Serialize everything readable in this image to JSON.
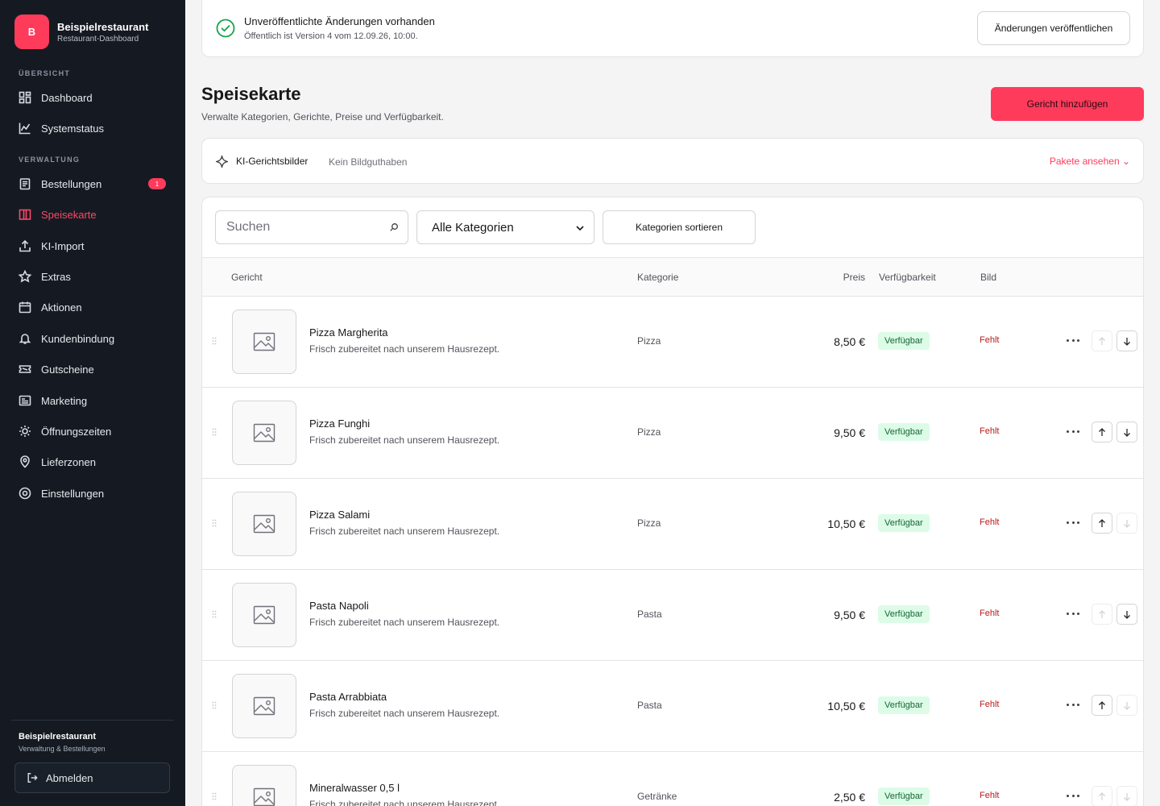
{
  "brand": {
    "initial": "B",
    "name": "Beispielrestaurant",
    "subtitle": "Restaurant-Dashboard"
  },
  "sidebar": {
    "section_overview": "ÜBERSICHT",
    "section_admin": "VERWALTUNG",
    "items": [
      {
        "label": "Dashboard",
        "icon": "dashboard-icon"
      },
      {
        "label": "Systemstatus",
        "icon": "chart-icon"
      },
      {
        "label": "Bestellungen",
        "icon": "clipboard-icon",
        "badge": "1"
      },
      {
        "label": "Speisekarte",
        "icon": "menu-book-icon",
        "active": true
      },
      {
        "label": "KI-Import",
        "icon": "upload-icon"
      },
      {
        "label": "Extras",
        "icon": "star-icon"
      },
      {
        "label": "Aktionen",
        "icon": "calendar-icon"
      },
      {
        "label": "Kundenbindung",
        "icon": "bell-icon"
      },
      {
        "label": "Gutscheine",
        "icon": "ticket-icon"
      },
      {
        "label": "Marketing",
        "icon": "newsletter-icon"
      },
      {
        "label": "Öffnungszeiten",
        "icon": "sun-icon"
      },
      {
        "label": "Lieferzonen",
        "icon": "map-pin-icon"
      },
      {
        "label": "Einstellungen",
        "icon": "settings-icon"
      }
    ],
    "footer": {
      "name": "Beispielrestaurant",
      "subtitle": "Verwaltung & Bestellungen",
      "logout": "Abmelden"
    }
  },
  "publish": {
    "title": "Unveröffentlichte Änderungen vorhanden",
    "subtitle": "Öffentlich ist Version 4 vom 12.09.26, 10:00.",
    "button": "Änderungen veröffentlichen"
  },
  "page": {
    "title": "Speisekarte",
    "subtitle": "Verwalte Kategorien, Gerichte, Preise und Verfügbarkeit.",
    "add_button": "Gericht hinzufügen"
  },
  "ai_images": {
    "title": "KI-Gerichtsbilder",
    "status": "Kein Bildguthaben",
    "link": "Pakete ansehen ⌄"
  },
  "toolbar": {
    "search_placeholder": "Suchen",
    "category_select": "Alle Kategorien",
    "sort_button": "Kategorien sortieren"
  },
  "table": {
    "headers": {
      "dish": "Gericht",
      "category": "Kategorie",
      "price": "Preis",
      "availability": "Verfügbarkeit",
      "image": "Bild"
    },
    "rows": [
      {
        "name": "Pizza Margherita",
        "description": "Frisch zubereitet nach unserem Hausrezept.",
        "category": "Pizza",
        "price": "8,50 €",
        "availability": "Verfügbar",
        "image": "Fehlt",
        "up_enabled": false,
        "down_enabled": true
      },
      {
        "name": "Pizza Funghi",
        "description": "Frisch zubereitet nach unserem Hausrezept.",
        "category": "Pizza",
        "price": "9,50 €",
        "availability": "Verfügbar",
        "image": "Fehlt",
        "up_enabled": true,
        "down_enabled": true
      },
      {
        "name": "Pizza Salami",
        "description": "Frisch zubereitet nach unserem Hausrezept.",
        "category": "Pizza",
        "price": "10,50 €",
        "availability": "Verfügbar",
        "image": "Fehlt",
        "up_enabled": true,
        "down_enabled": false
      },
      {
        "name": "Pasta Napoli",
        "description": "Frisch zubereitet nach unserem Hausrezept.",
        "category": "Pasta",
        "price": "9,50 €",
        "availability": "Verfügbar",
        "image": "Fehlt",
        "up_enabled": false,
        "down_enabled": true
      },
      {
        "name": "Pasta Arrabbiata",
        "description": "Frisch zubereitet nach unserem Hausrezept.",
        "category": "Pasta",
        "price": "10,50 €",
        "availability": "Verfügbar",
        "image": "Fehlt",
        "up_enabled": true,
        "down_enabled": false
      },
      {
        "name": "Mineralwasser 0,5 l",
        "description": "Frisch zubereitet nach unserem Hausrezept.",
        "category": "Getränke",
        "price": "2,50 €",
        "availability": "Verfügbar",
        "image": "Fehlt",
        "up_enabled": false,
        "down_enabled": false
      }
    ]
  },
  "colors": {
    "accent": "#ff3b5c",
    "sidebar_bg": "#151a22",
    "success_bg": "#dcfce7",
    "success_text": "#166534",
    "danger_text": "#b91c1c"
  }
}
